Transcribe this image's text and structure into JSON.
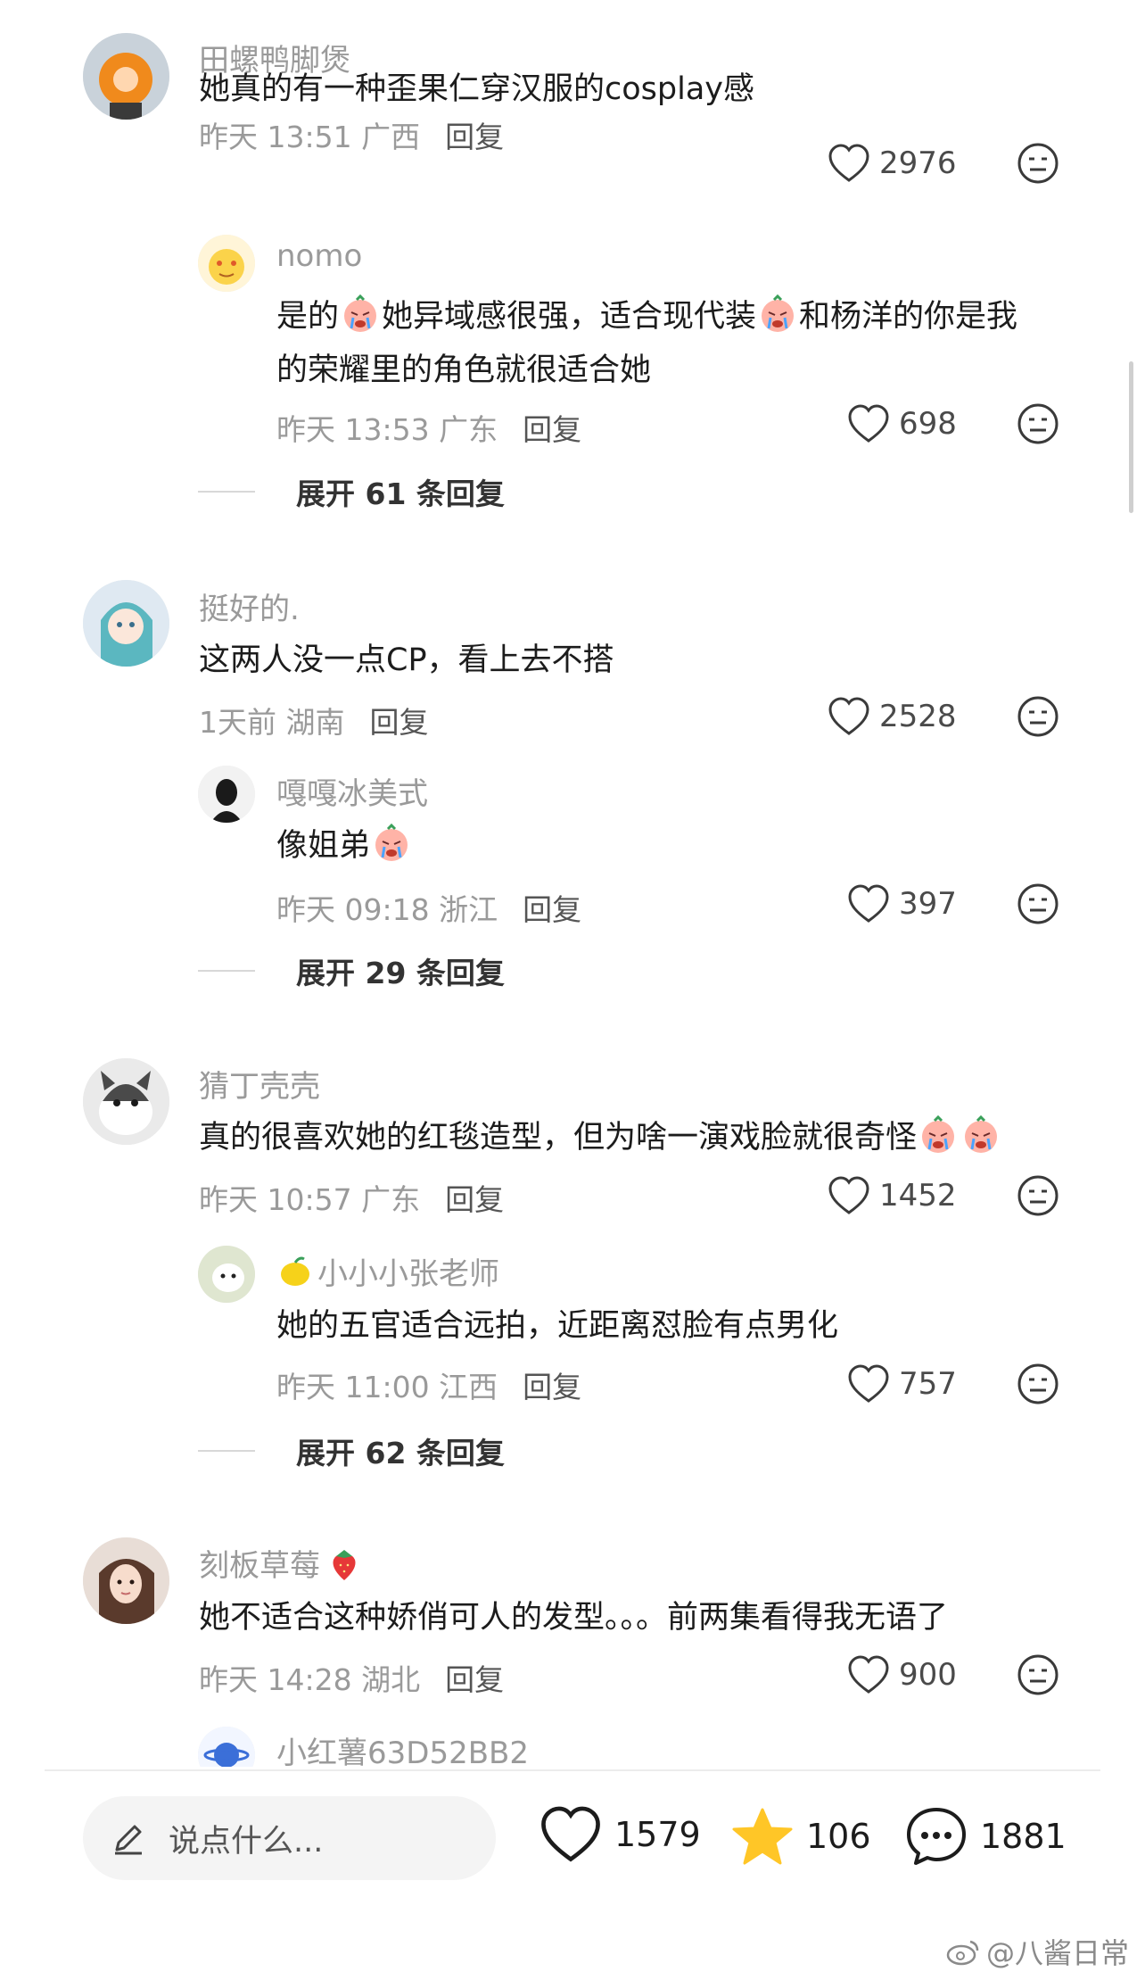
{
  "comments": [
    {
      "user": "田螺鸭脚煲",
      "text": "她真的有一种歪果仁穿汉服的cosplay感",
      "time": "昨天 13:51 广西",
      "reply_label": "回复",
      "likes": "2976",
      "reply": {
        "user": "nomo",
        "text_parts": [
          "是的",
          "她异域感很强，适合现代装",
          "和杨洋的你是我",
          "的荣耀里的角色就很适合她"
        ],
        "time": "昨天 13:53 广东",
        "reply_label": "回复",
        "likes": "698"
      },
      "expand": "展开 61 条回复"
    },
    {
      "user": "挺好的.",
      "text": "这两人没一点CP，看上去不搭",
      "time": "1天前 湖南",
      "reply_label": "回复",
      "likes": "2528",
      "reply": {
        "user": "嘎嘎冰美式",
        "text": "像姐弟",
        "time": "昨天 09:18 浙江",
        "reply_label": "回复",
        "likes": "397"
      },
      "expand": "展开 29 条回复"
    },
    {
      "user": "猜丁壳壳",
      "text": "真的很喜欢她的红毯造型，但为啥一演戏脸就很奇怪",
      "time": "昨天 10:57 广东",
      "reply_label": "回复",
      "likes": "1452",
      "reply": {
        "user": "小小小张老师",
        "text": "她的五官适合远拍，近距离怼脸有点男化",
        "time": "昨天 11:00 江西",
        "reply_label": "回复",
        "likes": "757"
      },
      "expand": "展开 62 条回复"
    },
    {
      "user": "刻板草莓",
      "text": "她不适合这种娇俏可人的发型。。。前两集看得我无语了",
      "time": "昨天 14:28 湖北",
      "reply_label": "回复",
      "likes": "900",
      "reply_partial_user": "小红薯63D52BB2"
    }
  ],
  "bottom_bar": {
    "input_placeholder": "说点什么...",
    "likes": "1579",
    "favorites": "106",
    "comments": "1881"
  },
  "watermark": "@八酱日常",
  "colors": {
    "star": "#FFC627",
    "muted": "#9a9a9a"
  }
}
